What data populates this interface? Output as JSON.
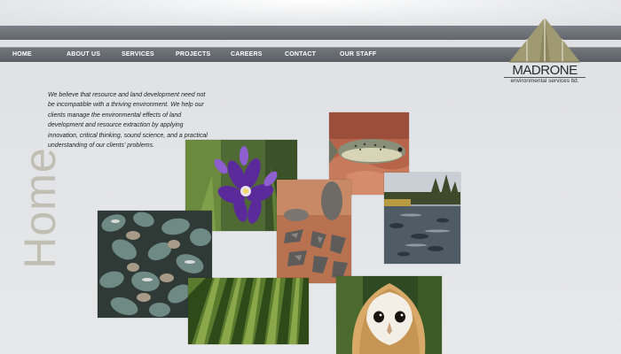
{
  "nav": {
    "items": [
      {
        "label": "HOME"
      },
      {
        "label": "ABOUT US"
      },
      {
        "label": "SERVICES"
      },
      {
        "label": "PROJECTS"
      },
      {
        "label": "CAREERS"
      },
      {
        "label": "CONTACT"
      },
      {
        "label": "OUR STAFF"
      }
    ]
  },
  "logo": {
    "name": "MADRONE",
    "tagline": "environmental services ltd."
  },
  "intro": {
    "text": "We believe that resource and land development need not be incompatible with a thriving environment. We help our clients manage the environmental effects of land development and resource extraction by applying innovation, critical thinking, sound science, and a practical understanding of our clients' problems."
  },
  "page": {
    "title": "Home"
  },
  "colors": {
    "nav_bar": "#62666d",
    "title_text": "#c1beb3",
    "logo_olive": "#a09a72"
  },
  "photos": [
    {
      "subject": "purple-flower"
    },
    {
      "subject": "trout-in-hand"
    },
    {
      "subject": "stone-tools"
    },
    {
      "subject": "forest-river"
    },
    {
      "subject": "mussel-shells"
    },
    {
      "subject": "vineyard-rows"
    },
    {
      "subject": "barn-owl"
    }
  ]
}
